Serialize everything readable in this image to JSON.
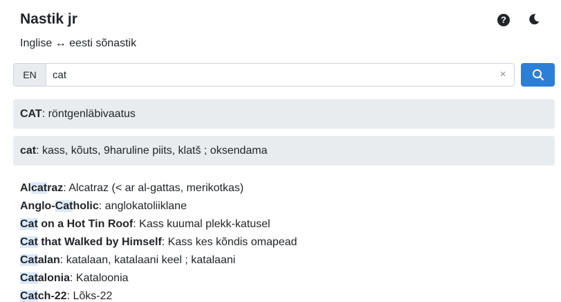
{
  "header": {
    "title": "Nastik jr",
    "subtitle": "Inglise ↔ eesti sõnastik",
    "help_icon": "?"
  },
  "search": {
    "lang": "EN",
    "value": "cat",
    "clear_icon": "×"
  },
  "results": [
    {
      "term": "CAT",
      "sep": ": ",
      "translation": "röntgenläbivaatus"
    },
    {
      "term": "cat",
      "sep": ": ",
      "translation": "kass, kõuts, 9haruline piits, klatš ; oksendama"
    }
  ],
  "related": [
    {
      "pre": "Al",
      "hl": "cat",
      "post": "raz",
      "translation": ": Alcatraz (< ar al-gattas, merikotkas)"
    },
    {
      "pre": "Anglo-",
      "hl": "Cat",
      "post": "holic",
      "translation": ": anglokatoliiklane"
    },
    {
      "pre": "",
      "hl": "Cat",
      "post": " on a Hot Tin Roof",
      "translation": ": Kass kuumal plekk-katusel"
    },
    {
      "pre": "",
      "hl": "Cat",
      "post": " that Walked by Himself",
      "translation": ": Kass kes kõndis omapead"
    },
    {
      "pre": "",
      "hl": "Cat",
      "post": "alan",
      "translation": ": katalaan, katalaani keel ; katalaani"
    },
    {
      "pre": "",
      "hl": "Cat",
      "post": "alonia",
      "translation": ": Kataloonia"
    },
    {
      "pre": "",
      "hl": "Cat",
      "post": "ch-22",
      "translation": ": Lõks-22"
    }
  ],
  "colors": {
    "accent": "#2b7fd6",
    "result_bg": "#e9ecef",
    "highlight": "#dbeafa"
  }
}
